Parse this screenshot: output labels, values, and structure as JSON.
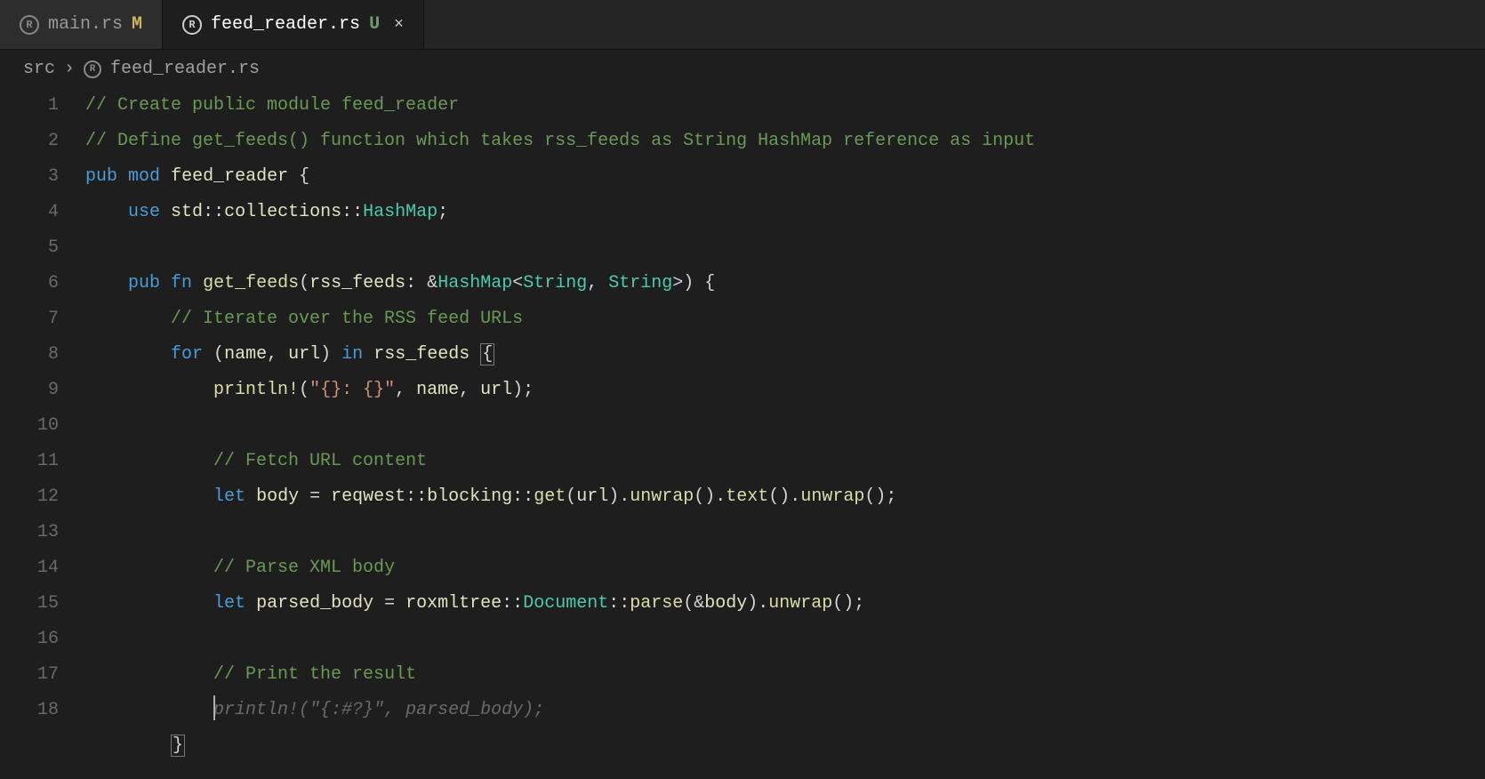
{
  "tabs": [
    {
      "filename": "main.rs",
      "git_status": "M",
      "active": false
    },
    {
      "filename": "feed_reader.rs",
      "git_status": "U",
      "active": true
    }
  ],
  "breadcrumb": {
    "folder": "src",
    "file": "feed_reader.rs"
  },
  "code": {
    "lines": [
      {
        "n": "1",
        "html": "<span class='c-comment'>// Create public module feed_reader</span>"
      },
      {
        "n": "2",
        "html": "<span class='c-comment'>// Define get_feeds() function which takes rss_feeds as String HashMap reference as input</span>"
      },
      {
        "n": "3",
        "html": "<span class='c-key'>pub</span> <span class='c-key'>mod</span> <span class='c-ident'>feed_reader</span> <span class='c-punct'>{</span>"
      },
      {
        "n": "4",
        "html": "    <span class='c-key'>use</span> <span class='c-ident'>std</span><span class='c-punct'>::</span><span class='c-ident'>collections</span><span class='c-punct'>::</span><span class='c-type'>HashMap</span><span class='c-punct'>;</span>"
      },
      {
        "n": "5",
        "html": " "
      },
      {
        "n": "6",
        "html": "    <span class='c-key'>pub</span> <span class='c-key'>fn</span> <span class='c-fn'>get_feeds</span><span class='c-punct'>(</span><span class='c-ident'>rss_feeds</span><span class='c-punct'>:</span> <span class='c-amp'>&amp;</span><span class='c-type'>HashMap</span><span class='c-punct'>&lt;</span><span class='c-type'>String</span><span class='c-punct'>,</span> <span class='c-type'>String</span><span class='c-punct'>&gt;) {</span>"
      },
      {
        "n": "7",
        "html": "        <span class='c-comment'>// Iterate over the RSS feed URLs</span>"
      },
      {
        "n": "8",
        "html": "        <span class='c-key'>for</span> <span class='c-punct'>(</span><span class='c-ident'>name</span><span class='c-punct'>,</span> <span class='c-ident'>url</span><span class='c-punct'>)</span> <span class='c-key'>in</span> <span class='c-ident'>rss_feeds</span> <span class='c-punct brace-match'>{</span>"
      },
      {
        "n": "9",
        "html": "            <span class='c-macro'>println!</span><span class='c-punct'>(</span><span class='c-str'>\"{}: {}\"</span><span class='c-punct'>,</span> <span class='c-ident'>name</span><span class='c-punct'>,</span> <span class='c-ident'>url</span><span class='c-punct'>);</span>"
      },
      {
        "n": "10",
        "html": " "
      },
      {
        "n": "11",
        "html": "            <span class='c-comment'>// Fetch URL content</span>"
      },
      {
        "n": "12",
        "html": "            <span class='c-key'>let</span> <span class='c-ident'>body</span> <span class='c-punct'>=</span> <span class='c-ident'>reqwest</span><span class='c-punct'>::</span><span class='c-ident'>blocking</span><span class='c-punct'>::</span><span class='c-fn'>get</span><span class='c-punct'>(</span><span class='c-ident'>url</span><span class='c-punct'>).</span><span class='c-fn'>unwrap</span><span class='c-punct'>().</span><span class='c-fn'>text</span><span class='c-punct'>().</span><span class='c-fn'>unwrap</span><span class='c-punct'>();</span>"
      },
      {
        "n": "13",
        "html": " "
      },
      {
        "n": "14",
        "html": "            <span class='c-comment'>// Parse XML body</span>"
      },
      {
        "n": "15",
        "html": "            <span class='c-key'>let</span> <span class='c-ident'>parsed_body</span> <span class='c-punct'>=</span> <span class='c-ident'>roxmltree</span><span class='c-punct'>::</span><span class='c-type'>Document</span><span class='c-punct'>::</span><span class='c-fn'>parse</span><span class='c-punct'>(&amp;</span><span class='c-ident'>body</span><span class='c-punct'>).</span><span class='c-fn'>unwrap</span><span class='c-punct'>();</span>"
      },
      {
        "n": "16",
        "html": " "
      },
      {
        "n": "17",
        "html": "            <span class='c-comment'>// Print the result</span>"
      },
      {
        "n": "18",
        "html": "            <span class='cursor'></span><span class='ghost'>println!(\"{:#?}\", parsed_body);</span>"
      },
      {
        "n": "",
        "html": "        <span class='c-punct brace-match'>}</span>"
      }
    ]
  }
}
